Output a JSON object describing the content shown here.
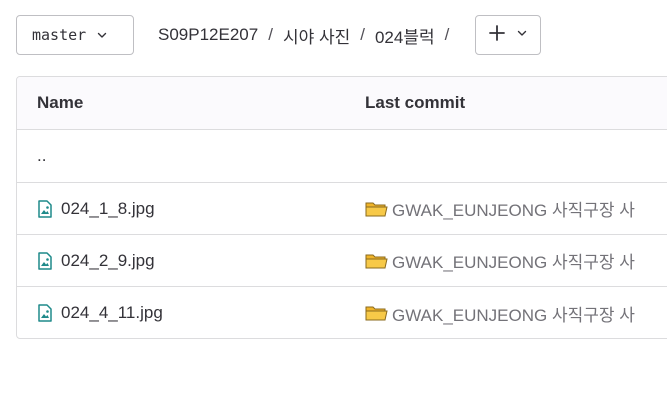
{
  "branch": {
    "label": "master"
  },
  "breadcrumb": {
    "items": [
      "S09P12E207",
      "시야 사진",
      "024블럭"
    ],
    "separator": "/"
  },
  "add_button": {
    "label": "+"
  },
  "table": {
    "headers": {
      "name": "Name",
      "last_commit": "Last commit"
    },
    "parent_link": "..",
    "rows": [
      {
        "name": "024_1_8.jpg",
        "commit": "GWAK_EUNJEONG 사직구장 사"
      },
      {
        "name": "024_2_9.jpg",
        "commit": "GWAK_EUNJEONG 사직구장 사"
      },
      {
        "name": "024_4_11.jpg",
        "commit": "GWAK_EUNJEONG 사직구장 사"
      }
    ]
  },
  "colors": {
    "image_icon": "#1f8a8a",
    "folder_icon": "#f0b429",
    "border": "#dcdcde"
  }
}
